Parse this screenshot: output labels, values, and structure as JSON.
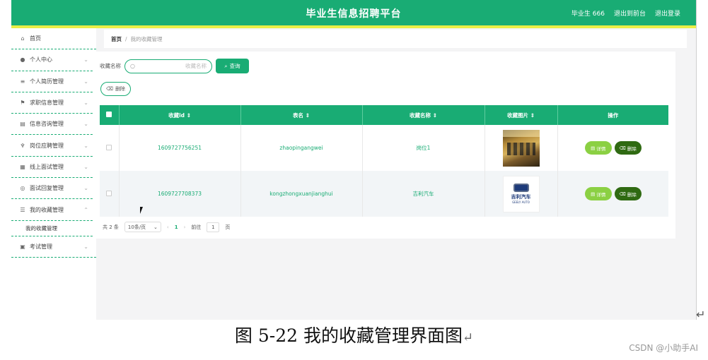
{
  "header": {
    "title": "毕业生信息招聘平台",
    "user": "毕业生 666",
    "back_label": "退出到前台",
    "logout_label": "退出登录"
  },
  "sidebar": {
    "items": [
      {
        "label": "首页",
        "icon": "home-icon",
        "has_chevron": false
      },
      {
        "label": "个人中心",
        "icon": "user-icon",
        "has_chevron": true
      },
      {
        "label": "个人简历管理",
        "icon": "list-icon",
        "has_chevron": true
      },
      {
        "label": "求职信息管理",
        "icon": "flag-icon",
        "has_chevron": true
      },
      {
        "label": "信息咨询管理",
        "icon": "document-icon",
        "has_chevron": true
      },
      {
        "label": "岗位应聘管理",
        "icon": "microphone-icon",
        "has_chevron": true
      },
      {
        "label": "线上面试管理",
        "icon": "grid-icon",
        "has_chevron": true
      },
      {
        "label": "面试回复管理",
        "icon": "globe-icon",
        "has_chevron": true
      },
      {
        "label": "我的收藏管理",
        "icon": "sliders-icon",
        "has_chevron": true,
        "expanded": true
      },
      {
        "label": "考试管理",
        "icon": "clipboard-icon",
        "has_chevron": true
      }
    ],
    "sub_item": "我的收藏管理"
  },
  "breadcrumb": {
    "home": "首页",
    "separator": "/",
    "current": "我的收藏管理"
  },
  "search": {
    "label": "收藏名称",
    "placeholder": "收藏名称",
    "button": "查询"
  },
  "toolbar": {
    "delete_label": "删除"
  },
  "table": {
    "headers": [
      "收藏id ⇕",
      "表名 ⇕",
      "收藏名称 ⇕",
      "收藏图片 ⇕",
      "操作"
    ],
    "rows": [
      {
        "id": "1609727756251",
        "table_name": "zhaopingangwei",
        "name": "岗位1",
        "image": "office-room-photo"
      },
      {
        "id": "1609727708373",
        "table_name": "kongzhongxuanjianghui",
        "name": "吉利汽车",
        "image": "geely-auto-logo"
      }
    ],
    "detail_label": "详情",
    "delete_label": "删除",
    "logo_text_cn": "吉利汽车",
    "logo_text_en": "GEELY AUTO"
  },
  "pagination": {
    "total": "共 2 条",
    "page_size": "10条/页",
    "current_page": "1",
    "goto_label": "前往",
    "goto_value": "1",
    "page_unit": "页"
  },
  "caption": {
    "text": "图 5-22 我的收藏管理界面图",
    "return_mark": "↵"
  },
  "watermark": "CSDN @小助手AI",
  "colors": {
    "primary": "#19ac74",
    "yellow": "#e9ee46",
    "detail": "#8bd043",
    "delete": "#2f6a12"
  }
}
